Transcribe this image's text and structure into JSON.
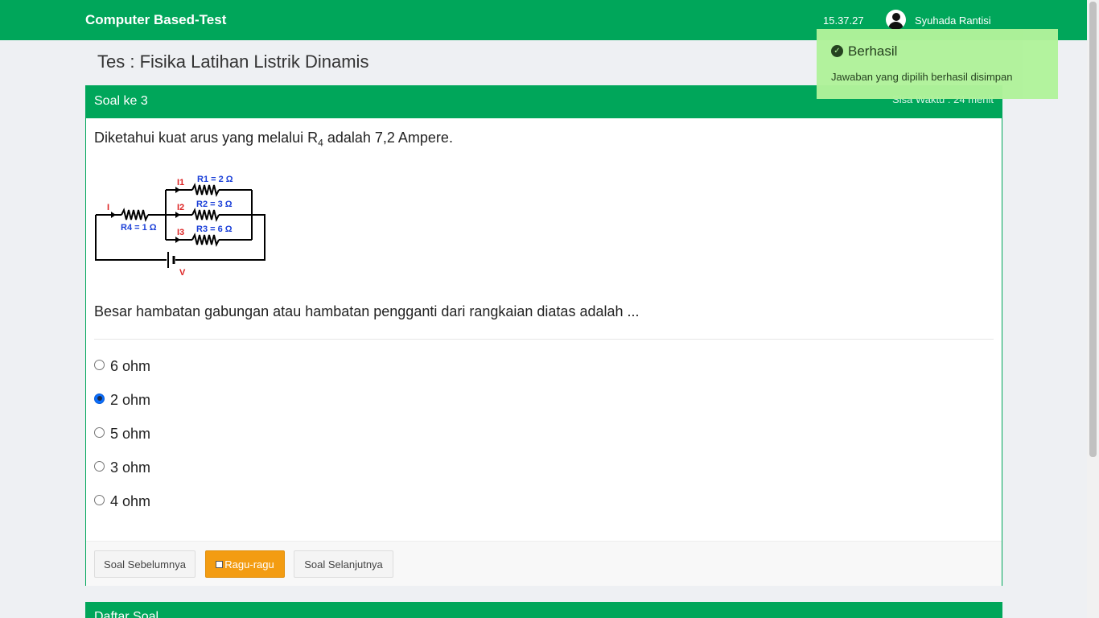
{
  "navbar": {
    "brand": "Computer Based-Test",
    "clock": "15.37.27",
    "user_name": "Syuhada Rantisi",
    "avatar_icon": "user-avatar-icon"
  },
  "page_title": "Tes : Fisika Latihan Listrik Dinamis",
  "question": {
    "header_label": "Soal ke 3",
    "timer": "Sisa Waktu : 24 menit",
    "intro_before": "Diketahui kuat arus yang melalui R",
    "intro_sub": "4",
    "intro_after": " adalah 7,2 Ampere.",
    "prompt": "Besar hambatan gabungan atau hambatan pengganti dari rangkaian diatas adalah ...",
    "circuit": {
      "I": "I",
      "I1": "I1",
      "I2": "I2",
      "I3": "I3",
      "R1": "R1 = 2 Ω",
      "R2": "R2 = 3 Ω",
      "R3": "R3 = 6 Ω",
      "R4": "R4 = 1 Ω",
      "V": "V"
    },
    "options": [
      {
        "label": "6 ohm",
        "selected": false
      },
      {
        "label": "2 ohm",
        "selected": true
      },
      {
        "label": "5 ohm",
        "selected": false
      },
      {
        "label": "3 ohm",
        "selected": false
      },
      {
        "label": "4 ohm",
        "selected": false
      }
    ]
  },
  "buttons": {
    "prev": "Soal Sebelumnya",
    "ragu": "Ragu-ragu",
    "next": "Soal Selanjutnya"
  },
  "question_list": {
    "title": "Daftar Soal"
  },
  "toast": {
    "title": "Berhasil",
    "message": "Jawaban yang dipilih berhasil disimpan",
    "icon": "check-circle-icon",
    "color": "#b1f39b"
  },
  "colors": {
    "primary": "#00a65a",
    "warning": "#f39c12",
    "radio_checked": "#0b6efd"
  }
}
